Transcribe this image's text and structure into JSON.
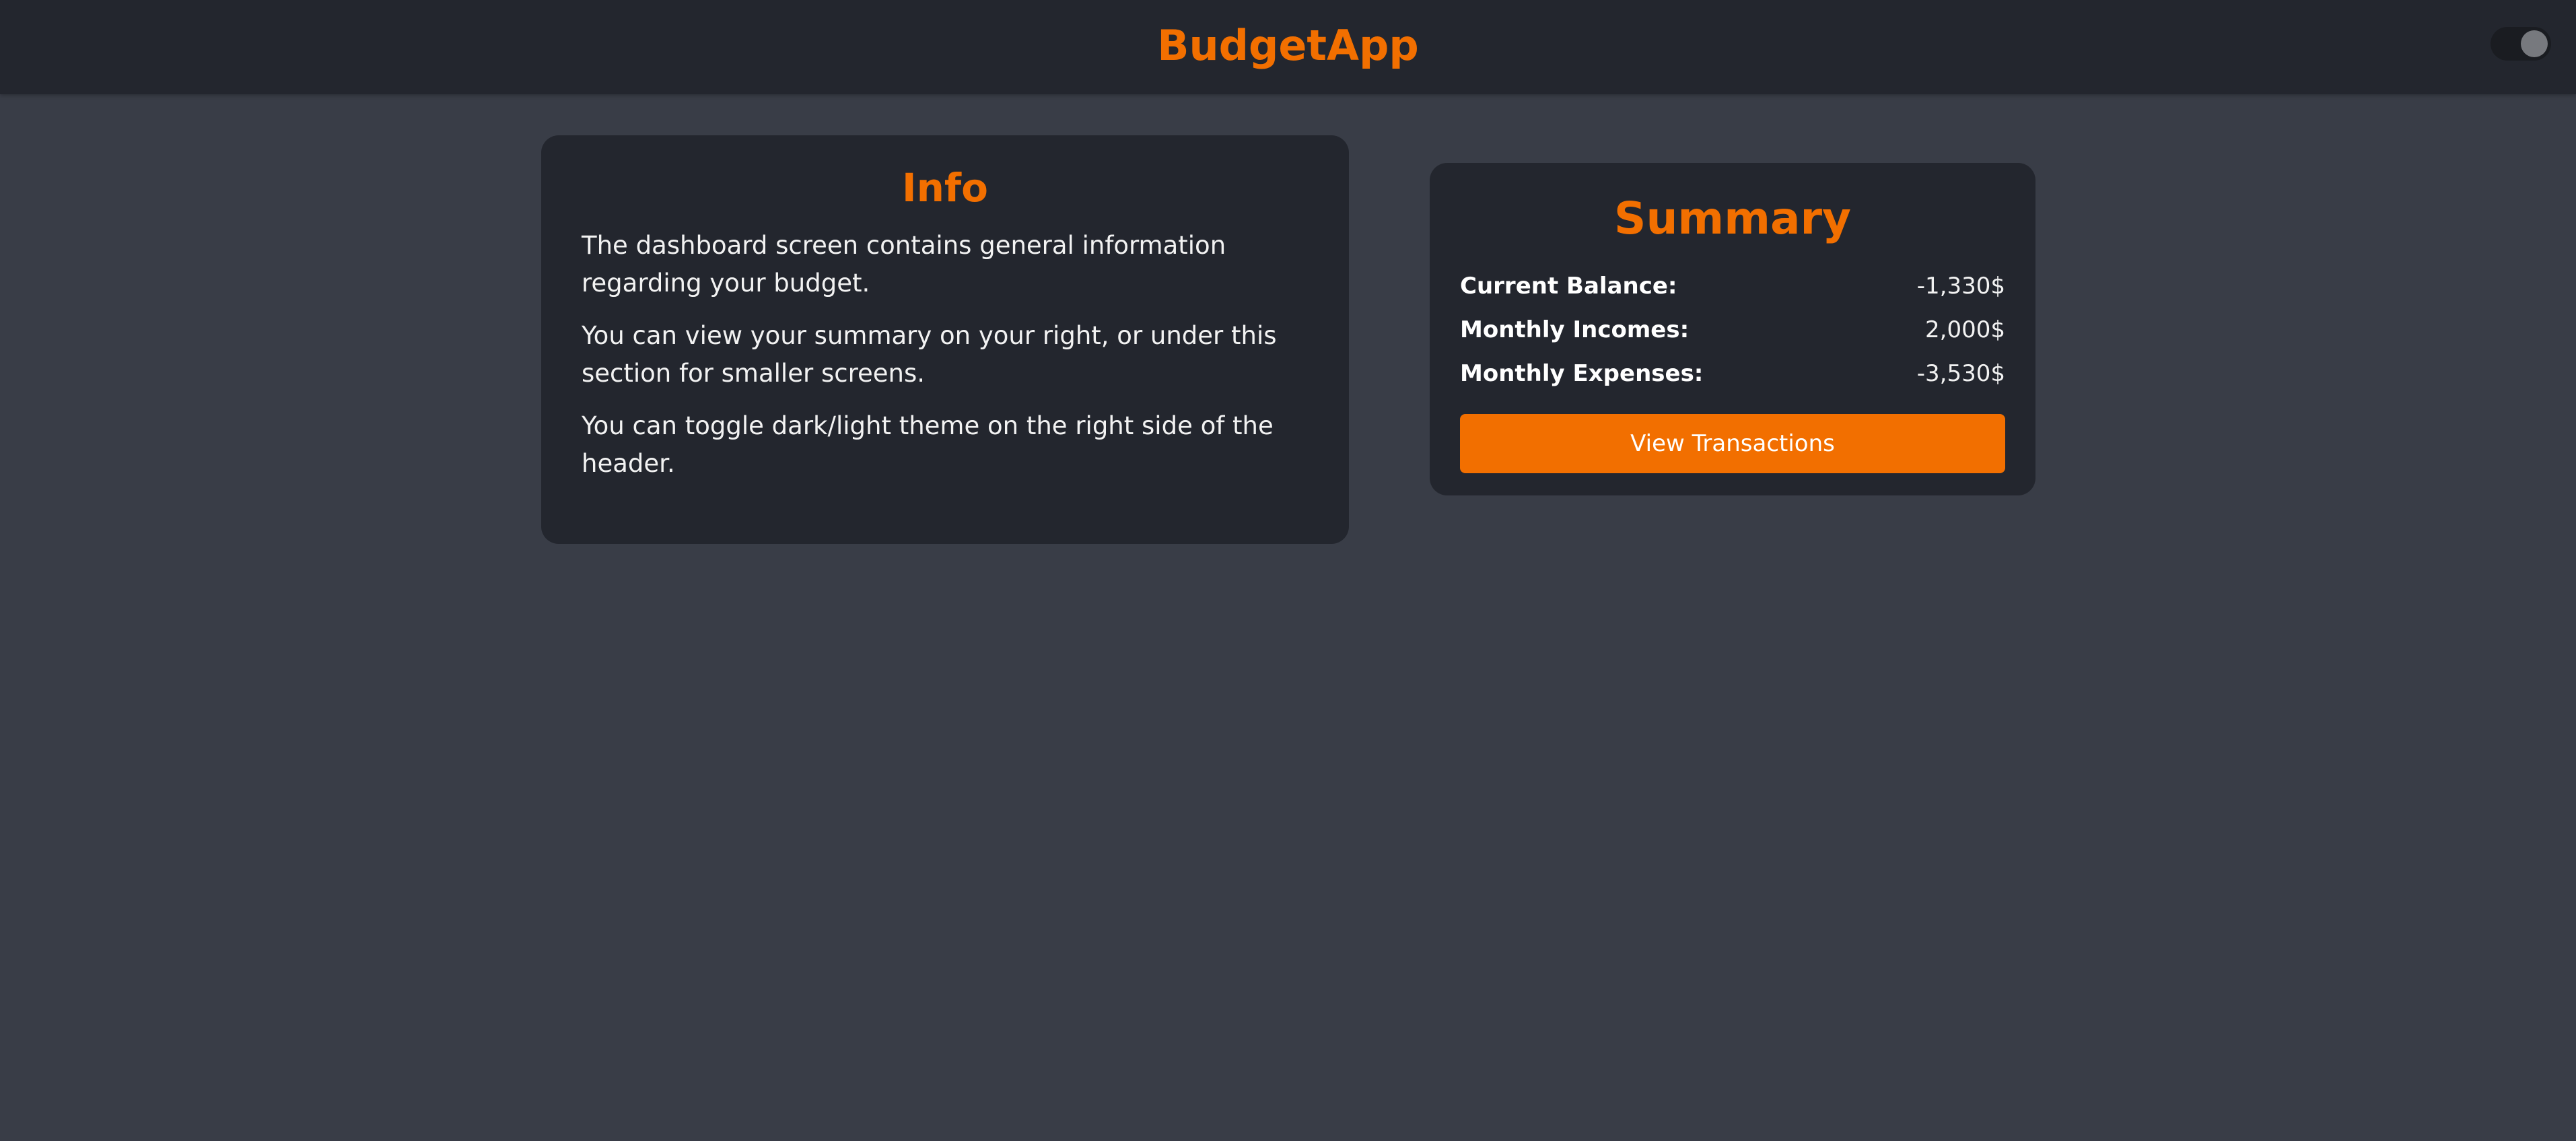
{
  "header": {
    "title": "BudgetApp",
    "theme_toggle": {
      "icon": "toggle-switch",
      "state": "dark"
    }
  },
  "info": {
    "title": "Info",
    "paragraphs": [
      "The dashboard screen contains general information regarding your budget.",
      "You can view your summary on your right, or under this section for smaller screens.",
      "You can toggle dark/light theme on the right side of the header."
    ]
  },
  "summary": {
    "title": "Summary",
    "rows": [
      {
        "label": "Current Balance:",
        "value": "-1,330$"
      },
      {
        "label": "Monthly Incomes:",
        "value": "2,000$"
      },
      {
        "label": "Monthly Expenses:",
        "value": "-3,530$"
      }
    ],
    "button_label": "View Transactions"
  },
  "colors": {
    "accent": "#f26f00",
    "background": "#393d47",
    "surface": "#23262e"
  }
}
